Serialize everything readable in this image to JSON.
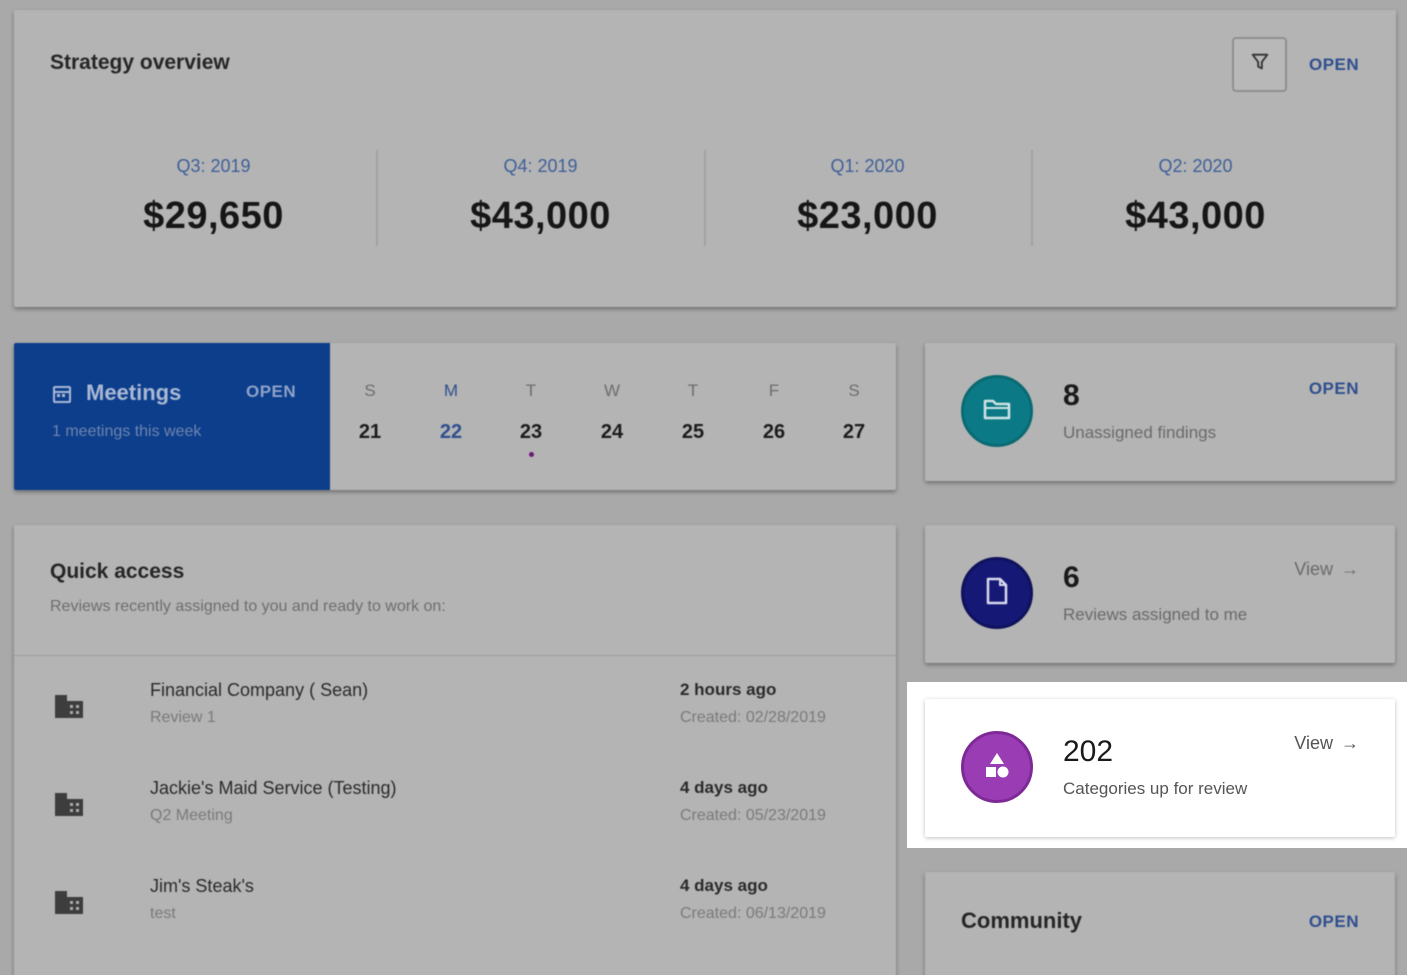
{
  "strategy": {
    "title": "Strategy overview",
    "open_label": "OPEN",
    "filter_icon": "filter-icon",
    "quarters": [
      {
        "label": "Q3: 2019",
        "value": "$29,650"
      },
      {
        "label": "Q4: 2019",
        "value": "$43,000"
      },
      {
        "label": "Q1: 2020",
        "value": "$23,000"
      },
      {
        "label": "Q2: 2020",
        "value": "$43,000"
      }
    ]
  },
  "meetings": {
    "title": "Meetings",
    "open_label": "OPEN",
    "subtitle": "1 meetings this week",
    "accent_color": "#0c3e8c",
    "days": [
      {
        "letter": "S",
        "num": "21"
      },
      {
        "letter": "M",
        "num": "22",
        "today": true
      },
      {
        "letter": "T",
        "num": "23",
        "has_event": true
      },
      {
        "letter": "W",
        "num": "24"
      },
      {
        "letter": "T",
        "num": "25"
      },
      {
        "letter": "F",
        "num": "26"
      },
      {
        "letter": "S",
        "num": "27"
      }
    ]
  },
  "quick_access": {
    "title": "Quick access",
    "subtitle": "Reviews recently assigned to you and ready to work on:",
    "items": [
      {
        "name": "Financial Company ( Sean)",
        "desc": "Review 1",
        "when": "2 hours ago",
        "created": "Created: 02/28/2019"
      },
      {
        "name": "Jackie's Maid Service (Testing)",
        "desc": "Q2 Meeting",
        "when": "4 days ago",
        "created": "Created: 05/23/2019"
      },
      {
        "name": "Jim's Steak's",
        "desc": "test",
        "when": "4 days ago",
        "created": "Created: 06/13/2019"
      }
    ]
  },
  "stats": {
    "findings": {
      "count": "8",
      "label": "Unassigned findings",
      "action": "OPEN",
      "icon": "folder-icon",
      "color": "#0c7a86"
    },
    "reviews": {
      "count": "6",
      "label": "Reviews assigned to me",
      "action": "View",
      "icon": "document-icon",
      "color": "#151875"
    },
    "categories": {
      "count": "202",
      "label": "Categories up for review",
      "action": "View",
      "icon": "shapes-icon",
      "color": "#9a3db5"
    }
  },
  "community": {
    "title": "Community",
    "open_label": "OPEN"
  }
}
